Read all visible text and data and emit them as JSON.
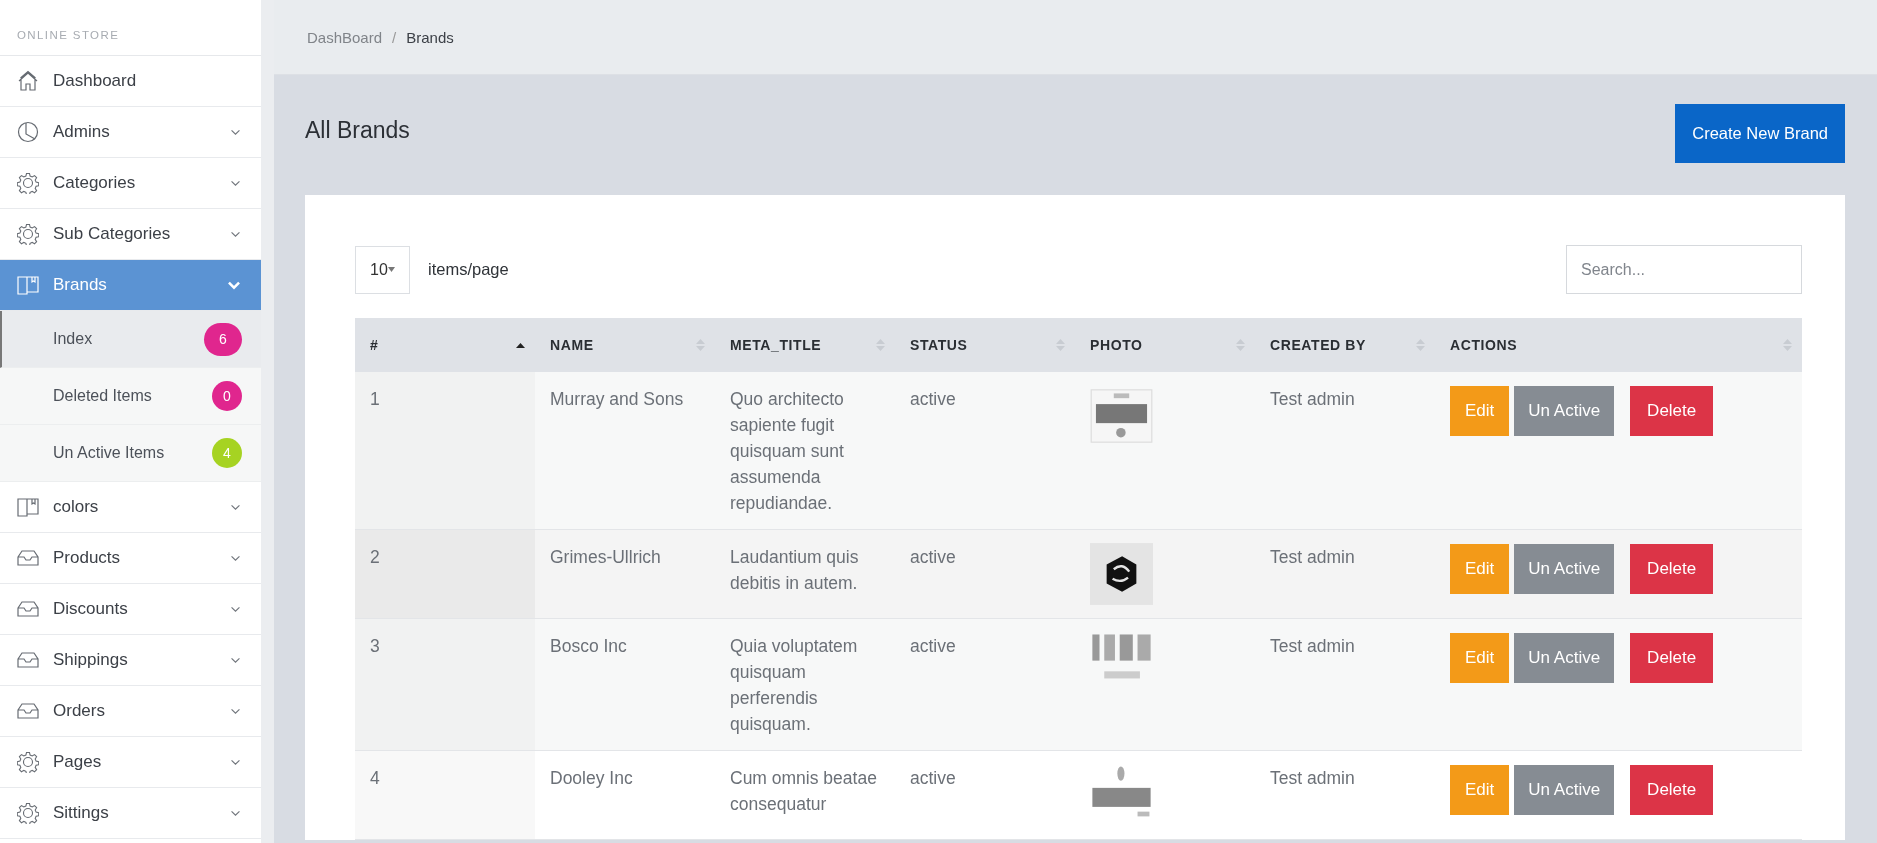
{
  "sidebar": {
    "heading": "ONLINE STORE",
    "items": [
      {
        "label": "Dashboard",
        "has_children": false,
        "selected": false
      },
      {
        "label": "Admins",
        "has_children": true,
        "expanded": false,
        "selected": false
      },
      {
        "label": "Categories",
        "has_children": true,
        "expanded": false,
        "selected": false
      },
      {
        "label": "Sub Categories",
        "has_children": true,
        "expanded": false,
        "selected": false
      },
      {
        "label": "Brands",
        "has_children": true,
        "expanded": true,
        "selected": true,
        "children": [
          {
            "label": "Index",
            "badge": "6",
            "color": "#e0268e",
            "selected": true
          },
          {
            "label": "Deleted Items",
            "badge": "0",
            "color": "#e0268e",
            "selected": false
          },
          {
            "label": "Un Active Items",
            "badge": "4",
            "color": "#a6d322",
            "selected": false
          }
        ]
      },
      {
        "label": "colors",
        "has_children": true,
        "expanded": false,
        "selected": false
      },
      {
        "label": "Products",
        "has_children": true,
        "expanded": false,
        "selected": false
      },
      {
        "label": "Discounts",
        "has_children": true,
        "expanded": false,
        "selected": false
      },
      {
        "label": "Shippings",
        "has_children": true,
        "expanded": false,
        "selected": false
      },
      {
        "label": "Orders",
        "has_children": true,
        "expanded": false,
        "selected": false
      },
      {
        "label": "Pages",
        "has_children": true,
        "expanded": false,
        "selected": false
      },
      {
        "label": "Sittings",
        "has_children": true,
        "expanded": false,
        "selected": false
      }
    ]
  },
  "breadcrumb": {
    "items": [
      "DashBoard",
      "Brands"
    ],
    "separator": "/"
  },
  "page_title": "All Brands",
  "create_button": "Create New Brand",
  "page_size": {
    "value": "10",
    "label": "items/page"
  },
  "search": {
    "placeholder": "Search..."
  },
  "table": {
    "columns": [
      {
        "label": "#",
        "sorted": true
      },
      {
        "label": "NAME",
        "sorted": false
      },
      {
        "label": "META_TITLE",
        "sorted": false
      },
      {
        "label": "STATUS",
        "sorted": false
      },
      {
        "label": "PHOTO",
        "sorted": false
      },
      {
        "label": "CREATED BY",
        "sorted": false
      },
      {
        "label": "ACTIONS",
        "sorted": false
      }
    ],
    "rows": [
      {
        "number": "1",
        "name": "Murray and Sons",
        "meta_title": "Quo architecto sapiente fugit quisquam sunt assumenda repudiandae.",
        "status": "active",
        "created_by": "Test admin",
        "actions": [
          {
            "label": "Edit",
            "kind": "edit"
          },
          {
            "label": "Un Active",
            "kind": "deactivate"
          },
          {
            "label": "Delete",
            "kind": "delete"
          }
        ]
      },
      {
        "number": "2",
        "name": "Grimes-Ullrich",
        "meta_title": "Laudantium quis debitis in autem.",
        "status": "active",
        "created_by": "Test admin",
        "actions": [
          {
            "label": "Edit",
            "kind": "edit"
          },
          {
            "label": "Un Active",
            "kind": "deactivate"
          },
          {
            "label": "Delete",
            "kind": "delete"
          }
        ]
      },
      {
        "number": "3",
        "name": "Bosco Inc",
        "meta_title": "Quia voluptatem quisquam perferendis quisquam.",
        "status": "active",
        "created_by": "Test admin",
        "actions": [
          {
            "label": "Edit",
            "kind": "edit"
          },
          {
            "label": "Un Active",
            "kind": "deactivate"
          },
          {
            "label": "Delete",
            "kind": "delete"
          }
        ]
      },
      {
        "number": "4",
        "name": "Dooley Inc",
        "meta_title": "Cum omnis beatae consequatur",
        "status": "active",
        "created_by": "Test admin",
        "actions": [
          {
            "label": "Edit",
            "kind": "edit"
          },
          {
            "label": "Un Active",
            "kind": "deactivate"
          },
          {
            "label": "Delete",
            "kind": "delete"
          }
        ]
      }
    ]
  }
}
